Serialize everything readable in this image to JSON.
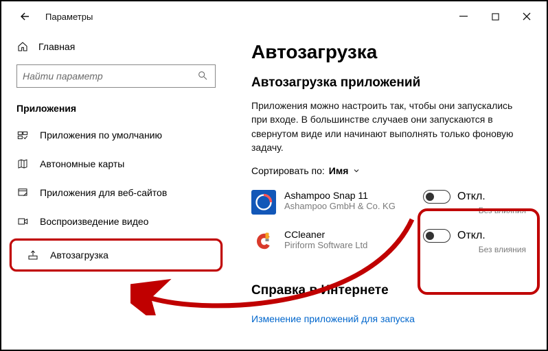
{
  "titlebar": {
    "title": "Параметры"
  },
  "sidebar": {
    "home": "Главная",
    "search_placeholder": "Найти параметр",
    "section": "Приложения",
    "items": [
      {
        "id": "default-apps",
        "label": "Приложения по умолчанию"
      },
      {
        "id": "offline-maps",
        "label": "Автономные карты"
      },
      {
        "id": "web-apps",
        "label": "Приложения для веб-сайтов"
      },
      {
        "id": "video-playback",
        "label": "Воспроизведение видео"
      },
      {
        "id": "startup",
        "label": "Автозагрузка"
      }
    ]
  },
  "main": {
    "title": "Автозагрузка",
    "subtitle": "Автозагрузка приложений",
    "description": "Приложения можно настроить так, чтобы они запускались при входе. В большинстве случаев они запускаются в свернутом виде или начинают выполнять только фоновую задачу.",
    "sort_label": "Сортировать по:",
    "sort_value": "Имя",
    "apps": [
      {
        "name": "Ashampoo Snap 11",
        "publisher": "Ashampoo GmbH & Co. KG",
        "state": "Откл.",
        "impact": "Без влияния"
      },
      {
        "name": "CCleaner",
        "publisher": "Piriform Software Ltd",
        "state": "Откл.",
        "impact": "Без влияния"
      }
    ],
    "help_title": "Справка в Интернете",
    "help_link": "Изменение приложений для запуска"
  }
}
